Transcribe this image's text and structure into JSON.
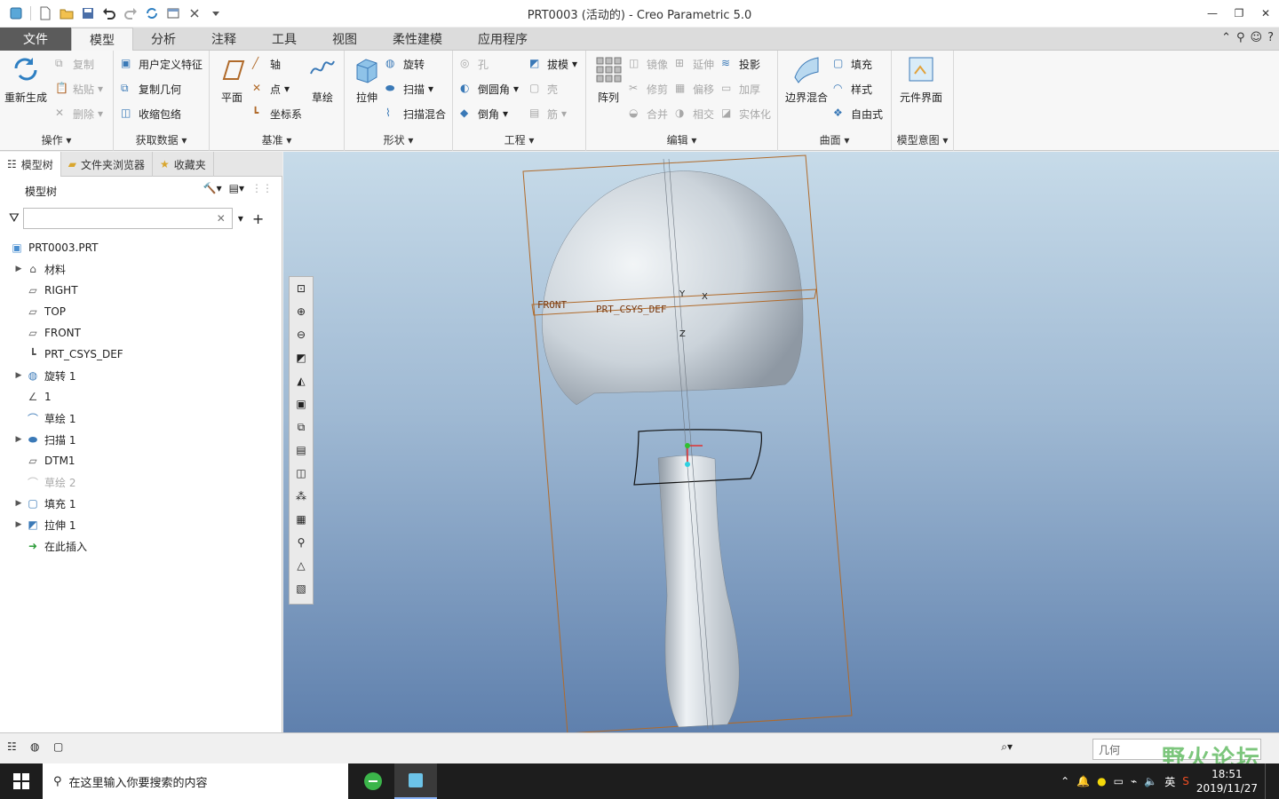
{
  "window": {
    "title": "PRT0003 (活动的) - Creo Parametric 5.0",
    "controls": [
      "—",
      "❐",
      "✕"
    ]
  },
  "tabs": [
    {
      "label": "文件",
      "kind": "file"
    },
    {
      "label": "模型",
      "kind": "active"
    },
    {
      "label": "分析"
    },
    {
      "label": "注释"
    },
    {
      "label": "工具"
    },
    {
      "label": "视图"
    },
    {
      "label": "柔性建模"
    },
    {
      "label": "应用程序"
    }
  ],
  "ribbon": {
    "operations": {
      "group_label": "操作 ▾",
      "regenerate": "重新生成",
      "copy": "复制",
      "paste": "粘贴",
      "delete": "删除"
    },
    "get_data": {
      "group_label": "获取数据 ▾",
      "udf": "用户定义特征",
      "copy_geom": "复制几何",
      "shrinkwrap": "收缩包络"
    },
    "datum": {
      "group_label": "基准 ▾",
      "plane": "平面",
      "axis": "轴",
      "point": "点",
      "csys": "坐标系",
      "sketch": "草绘"
    },
    "shapes": {
      "group_label": "形状 ▾",
      "extrude": "拉伸",
      "revolve": "旋转",
      "sweep": "扫描",
      "swept_blend": "扫描混合"
    },
    "engineering": {
      "group_label": "工程 ▾",
      "hole": "孔",
      "round": "倒圆角",
      "chamfer": "倒角",
      "draft": "拔模",
      "shell": "壳",
      "rib": "筋"
    },
    "editing": {
      "group_label": "编辑 ▾",
      "pattern": "阵列",
      "mirror": "镜像",
      "trim": "修剪",
      "merge": "合并",
      "extend": "延伸",
      "offset": "偏移",
      "intersect": "相交",
      "project": "投影",
      "thicken": "加厚",
      "solidify": "实体化"
    },
    "surfaces": {
      "group_label": "曲面 ▾",
      "boundary_blend": "边界混合",
      "fill": "填充",
      "style": "样式",
      "freestyle": "自由式"
    },
    "model_intent": {
      "group_label": "模型意图 ▾",
      "component_interface": "元件界面"
    }
  },
  "panel": {
    "tabs": [
      "模型树",
      "文件夹浏览器",
      "收藏夹"
    ],
    "header": "模型树",
    "filter_placeholder": "",
    "tree": [
      {
        "label": "PRT0003.PRT",
        "icon": "part-icon",
        "expandable": false,
        "indent": 0
      },
      {
        "label": "材料",
        "icon": "material-icon",
        "expandable": true,
        "indent": 1
      },
      {
        "label": "RIGHT",
        "icon": "datum-plane-icon",
        "expandable": false,
        "indent": 1
      },
      {
        "label": "TOP",
        "icon": "datum-plane-icon",
        "expandable": false,
        "indent": 1
      },
      {
        "label": "FRONT",
        "icon": "datum-plane-icon",
        "expandable": false,
        "indent": 1
      },
      {
        "label": "PRT_CSYS_DEF",
        "icon": "csys-icon",
        "expandable": false,
        "indent": 1
      },
      {
        "label": "旋转 1",
        "icon": "revolve-icon",
        "expandable": true,
        "indent": 1
      },
      {
        "label": "1",
        "icon": "graph-icon",
        "expandable": false,
        "indent": 1
      },
      {
        "label": "草绘 1",
        "icon": "sketch-icon",
        "expandable": false,
        "indent": 1
      },
      {
        "label": "扫描 1",
        "icon": "sweep-icon",
        "expandable": true,
        "indent": 1
      },
      {
        "label": "DTM1",
        "icon": "datum-plane-icon",
        "expandable": false,
        "indent": 1
      },
      {
        "label": "草绘 2",
        "icon": "sketch-icon",
        "expandable": false,
        "indent": 1,
        "grey": true
      },
      {
        "label": "填充 1",
        "icon": "fill-icon",
        "expandable": true,
        "indent": 1
      },
      {
        "label": "拉伸 1",
        "icon": "extrude-icon",
        "expandable": true,
        "indent": 1
      },
      {
        "label": "在此插入",
        "icon": "insert-here-icon",
        "expandable": false,
        "indent": 1
      }
    ]
  },
  "viewport": {
    "labels": {
      "front": "FRONT",
      "csys": "PRT_CSYS_DEF",
      "x": "X",
      "y": "Y",
      "z": "Z"
    }
  },
  "statusbar": {
    "selection_filter": "几何",
    "watermark": "野火论坛"
  },
  "taskbar": {
    "search_placeholder": "在这里输入你要搜索的内容",
    "ime": "英",
    "time": "18:51",
    "date": "2019/11/27"
  },
  "colors": {
    "file_tab": "#5b5b5b",
    "datum_orange": "#b06a2a",
    "viewport_top": "#c7dbe9",
    "viewport_bottom": "#5f80ad"
  }
}
